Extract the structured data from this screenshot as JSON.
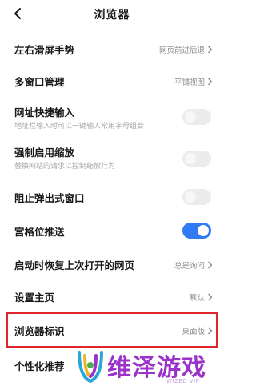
{
  "header": {
    "title": "浏览器"
  },
  "settings": [
    {
      "label": "左右滑屏手势",
      "value": "网页前进后退"
    },
    {
      "label": "多窗口管理",
      "value": "平铺视图"
    },
    {
      "label": "网址快捷输入",
      "subtitle": "地址栏输入时可以一键输入常用字母组合",
      "toggle_on": false
    },
    {
      "label": "强制启用缩放",
      "subtitle": "替换网站的请求以控制缩放行为",
      "toggle_on": false
    },
    {
      "label": "阻止弹出式窗口",
      "toggle_on": false
    },
    {
      "label": "宫格位推送",
      "toggle_on": true
    },
    {
      "label": "启动时恢复上次打开的网页",
      "value": "总是询问"
    },
    {
      "label": "设置主页",
      "value": "默认"
    },
    {
      "label": "浏览器标识",
      "value": "桌面版"
    },
    {
      "label": "个性化推荐"
    }
  ],
  "highlight_color": "#e0262c",
  "accent_color": "#2f7bf5",
  "watermark": {
    "text": "维泽游戏",
    "url": "WIZED VIP"
  }
}
